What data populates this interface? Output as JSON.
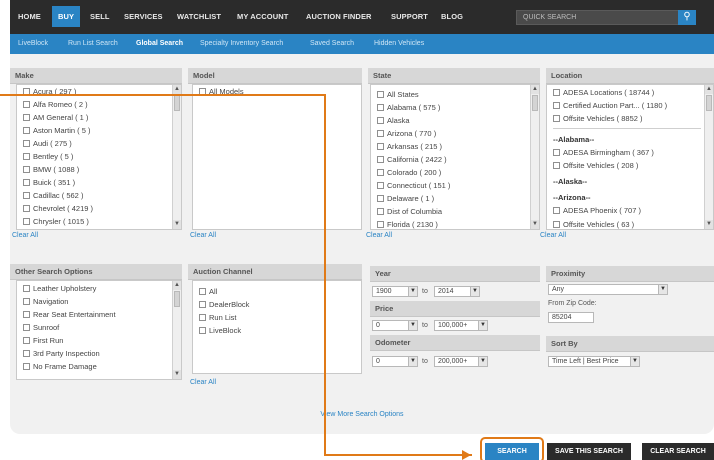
{
  "topnav": {
    "items": [
      {
        "label": "HOME"
      },
      {
        "label": "BUY"
      },
      {
        "label": "SELL"
      },
      {
        "label": "SERVICES"
      },
      {
        "label": "WATCHLIST"
      },
      {
        "label": "MY ACCOUNT"
      },
      {
        "label": "AUCTION FINDER"
      },
      {
        "label": "SUPPORT"
      },
      {
        "label": "BLOG"
      }
    ],
    "active": "BUY",
    "quick_search_placeholder": "QUICK SEARCH",
    "search_icon": "search-icon"
  },
  "subnav": {
    "items": [
      {
        "label": "LiveBlock"
      },
      {
        "label": "Run List Search"
      },
      {
        "label": "Global Search"
      },
      {
        "label": "Specialty Inventory Search"
      },
      {
        "label": "Saved Search"
      },
      {
        "label": "Hidden Vehicles"
      }
    ],
    "active": "Global Search"
  },
  "make": {
    "title": "Make",
    "options": [
      "Acura ( 297 )",
      "Alfa Romeo ( 2 )",
      "AM General ( 1 )",
      "Aston Martin ( 5 )",
      "Audi ( 275 )",
      "Bentley ( 5 )",
      "BMW ( 1088 )",
      "Buick ( 351 )",
      "Cadillac ( 562 )",
      "Chevrolet ( 4219 )",
      "Chrysler ( 1015 )"
    ],
    "clear_label": "Clear All"
  },
  "model": {
    "title": "Model",
    "options": [
      "All Models"
    ],
    "clear_label": "Clear All"
  },
  "state": {
    "title": "State",
    "options": [
      "All States",
      "Alabama ( 575 )",
      "Alaska",
      "Arizona ( 770 )",
      "Arkansas ( 215 )",
      "California ( 2422 )",
      "Colorado ( 200 )",
      "Connecticut ( 151 )",
      "Delaware ( 1 )",
      "Dist of Columbia",
      "Florida ( 2130 )"
    ],
    "clear_label": "Clear All"
  },
  "location": {
    "title": "Location",
    "top_options": [
      "ADESA Locations ( 18744 )",
      "Certified Auction Part... ( 1180 )",
      "Offsite Vehicles ( 8852 )"
    ],
    "groups": [
      {
        "name": "--Alabama--",
        "options": [
          "ADESA Birmingham ( 367 )",
          "Offsite Vehicles ( 208 )"
        ]
      },
      {
        "name": "--Alaska--",
        "options": []
      },
      {
        "name": "--Arizona--",
        "options": [
          "ADESA Phoenix ( 707 )",
          "Offsite Vehicles ( 63 )"
        ]
      }
    ],
    "clear_label": "Clear All"
  },
  "other": {
    "title": "Other Search Options",
    "options": [
      "Leather Upholstery",
      "Navigation",
      "Rear Seat Entertainment",
      "Sunroof",
      "First Run",
      "3rd Party Inspection",
      "No Frame Damage"
    ]
  },
  "auction": {
    "title": "Auction Channel",
    "options": [
      "All",
      "DealerBlock",
      "Run List",
      "LiveBlock"
    ],
    "clear_label": "Clear All"
  },
  "year": {
    "title": "Year",
    "from": "1900",
    "to_label": "to",
    "to": "2014"
  },
  "price": {
    "title": "Price",
    "from": "0",
    "to_label": "to",
    "to": "100,000+"
  },
  "odometer": {
    "title": "Odometer",
    "from": "0",
    "to_label": "to",
    "to": "200,000+"
  },
  "proximity": {
    "title": "Proximity",
    "value": "Any",
    "zip_label": "From Zip Code:",
    "zip_value": "85204"
  },
  "sortby": {
    "title": "Sort By",
    "value": "Time Left | Best Price"
  },
  "view_more": "View More Search Options",
  "buttons": {
    "search": "SEARCH",
    "save": "SAVE THIS SEARCH",
    "clear": "CLEAR SEARCH"
  },
  "colors": {
    "brand_blue": "#2a84c4",
    "highlight_orange": "#e07a18",
    "nav_dark": "#2b2b2b"
  }
}
